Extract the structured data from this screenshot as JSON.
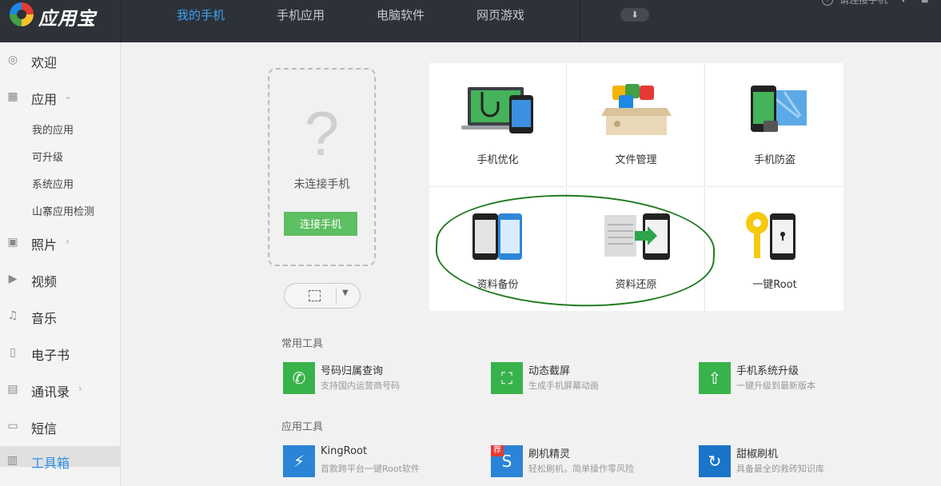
{
  "app": {
    "name": "应用宝"
  },
  "top_nav": [
    {
      "label": "我的手机",
      "active": true
    },
    {
      "label": "手机应用",
      "active": false
    },
    {
      "label": "电脑软件",
      "active": false
    },
    {
      "label": "网页游戏",
      "active": false
    }
  ],
  "header_right": {
    "connect_text": "请连接手机"
  },
  "sidebar": {
    "items": [
      {
        "label": "欢迎",
        "icon": "welcome-icon"
      },
      {
        "label": "应用",
        "icon": "apps-grid-icon",
        "expanded": true
      },
      {
        "label": "照片",
        "icon": "photo-icon"
      },
      {
        "label": "视频",
        "icon": "video-icon"
      },
      {
        "label": "音乐",
        "icon": "music-icon"
      },
      {
        "label": "电子书",
        "icon": "ebook-icon"
      },
      {
        "label": "通讯录",
        "icon": "contacts-icon"
      },
      {
        "label": "短信",
        "icon": "sms-icon"
      },
      {
        "label": "工具箱",
        "icon": "toolbox-icon",
        "active": true
      }
    ],
    "sub_items": [
      "我的应用",
      "可升级",
      "系统应用",
      "山寨应用检测"
    ]
  },
  "phone_panel": {
    "question_mark": "?",
    "status_text": "未连接手机",
    "connect_button": "连接手机"
  },
  "feature_grid": [
    {
      "label": "手机优化",
      "icon": "phone-optimize-icon"
    },
    {
      "label": "文件管理",
      "icon": "file-manager-icon"
    },
    {
      "label": "手机防盗",
      "icon": "phone-antitheft-icon"
    },
    {
      "label": "资料备份",
      "icon": "data-backup-icon"
    },
    {
      "label": "资料还原",
      "icon": "data-restore-icon"
    },
    {
      "label": "一键Root",
      "icon": "one-click-root-icon"
    }
  ],
  "common_tools": {
    "title": "常用工具",
    "items": [
      {
        "name": "号码归属查询",
        "desc": "支持国内运营商号码",
        "icon": "phone-lookup-icon"
      },
      {
        "name": "动态截屏",
        "desc": "生成手机屏幕动画",
        "icon": "screen-capture-icon"
      },
      {
        "name": "手机系统升级",
        "desc": "一键升级到最新版本",
        "icon": "system-upgrade-icon"
      }
    ]
  },
  "app_tools": {
    "title": "应用工具",
    "items": [
      {
        "name": "KingRoot",
        "desc": "首款跨平台一键Root软件",
        "icon": "kingroot-icon",
        "color": "#2b84d8"
      },
      {
        "name": "刷机精灵",
        "desc": "轻松刷机，简单操作零风险",
        "icon": "flash-tool-icon",
        "color": "#2b84d8",
        "badge": "荐"
      },
      {
        "name": "甜椒刷机",
        "desc": "具备最全的救砖知识库",
        "icon": "tianjiao-icon",
        "color": "#1a74c9"
      }
    ]
  },
  "colors": {
    "topbar": "#2d3138",
    "active_nav": "#3ea1f3",
    "green": "#5cbf61",
    "annotation": "#1f7a1f"
  }
}
